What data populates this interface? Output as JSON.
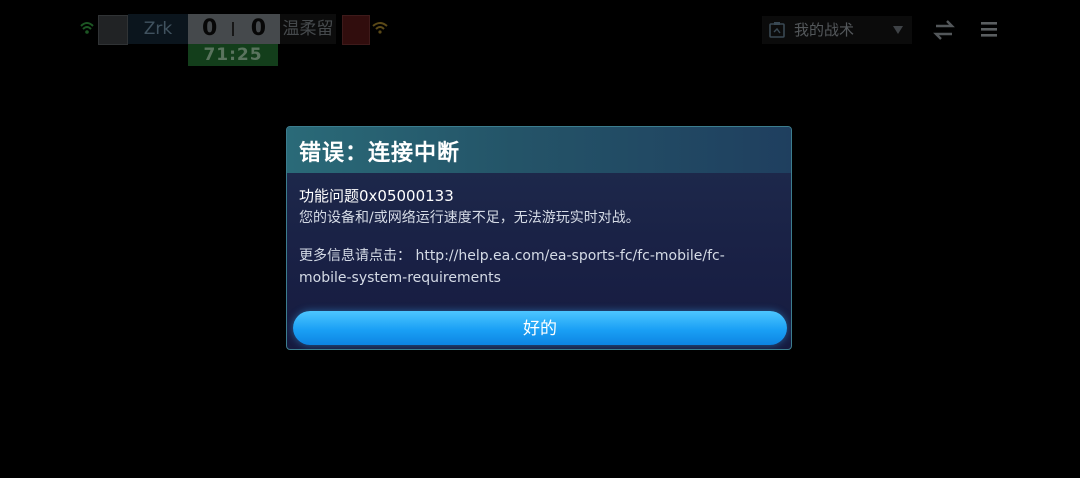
{
  "scoreboard": {
    "home_name": "Zrk",
    "home_score": "0",
    "away_score": "0",
    "away_name": "温柔留",
    "match_time": "71:25"
  },
  "toolbar": {
    "tactics_label": "我的战术"
  },
  "dialog": {
    "title": "错误：连接中断",
    "error_code": "功能问题0x05000133",
    "description": "您的设备和/或网络运行速度不足，无法游玩实时对战。",
    "more_info_prefix": "更多信息请点击：",
    "more_info_url": "http://help.ea.com/ea-sports-fc/fc-mobile/fc-mobile-system-requirements",
    "ok_label": "好的"
  },
  "colors": {
    "accent": "#1aa0f5",
    "timer_green": "#2b8a3c",
    "dialog_border": "#3c7d8e"
  },
  "icons": [
    "wifi-icon",
    "team-crest-icon",
    "tactics-board-icon",
    "chevron-down-icon",
    "swap-icon",
    "menu-icon"
  ]
}
